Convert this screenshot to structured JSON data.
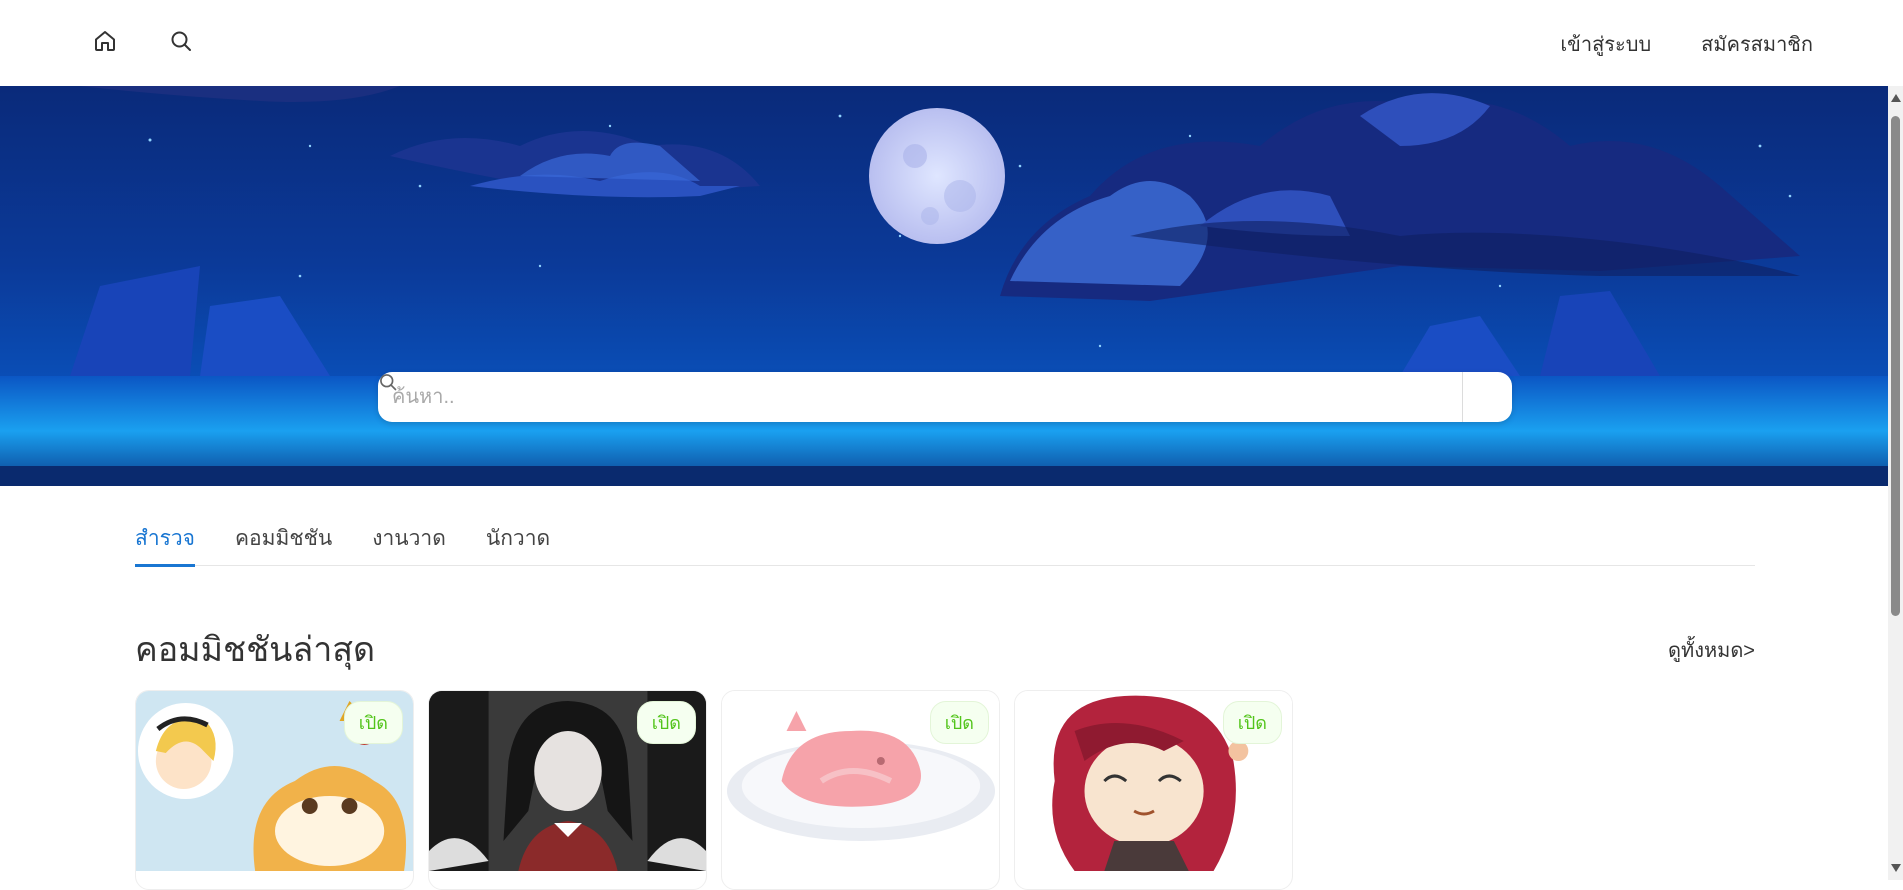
{
  "header": {
    "login_label": "เข้าสู่ระบบ",
    "register_label": "สมัครสมาชิก"
  },
  "hero": {
    "search_placeholder": "ค้นหา.."
  },
  "tabs": [
    {
      "label": "สำรวจ",
      "active": true
    },
    {
      "label": "คอมมิชชัน",
      "active": false
    },
    {
      "label": "งานวาด",
      "active": false
    },
    {
      "label": "นักวาด",
      "active": false
    }
  ],
  "section": {
    "title": "คอมมิชชันล่าสุด",
    "view_all_label": "ดูทั้งหมด>"
  },
  "cards": [
    {
      "badge": "เปิด",
      "image": "alice-and-shiba-illustration"
    },
    {
      "badge": "เปิด",
      "image": "dark-hair-girl-illustration"
    },
    {
      "badge": "เปิด",
      "image": "pink-jelly-fish-plate-illustration"
    },
    {
      "badge": "เปิด",
      "image": "red-hair-chibi-illustration"
    }
  ],
  "colors": {
    "accent": "#1976d2",
    "badge_text": "#52c41a",
    "hero_top": "#0a2a7a",
    "hero_bottom": "#0b6fd6"
  }
}
